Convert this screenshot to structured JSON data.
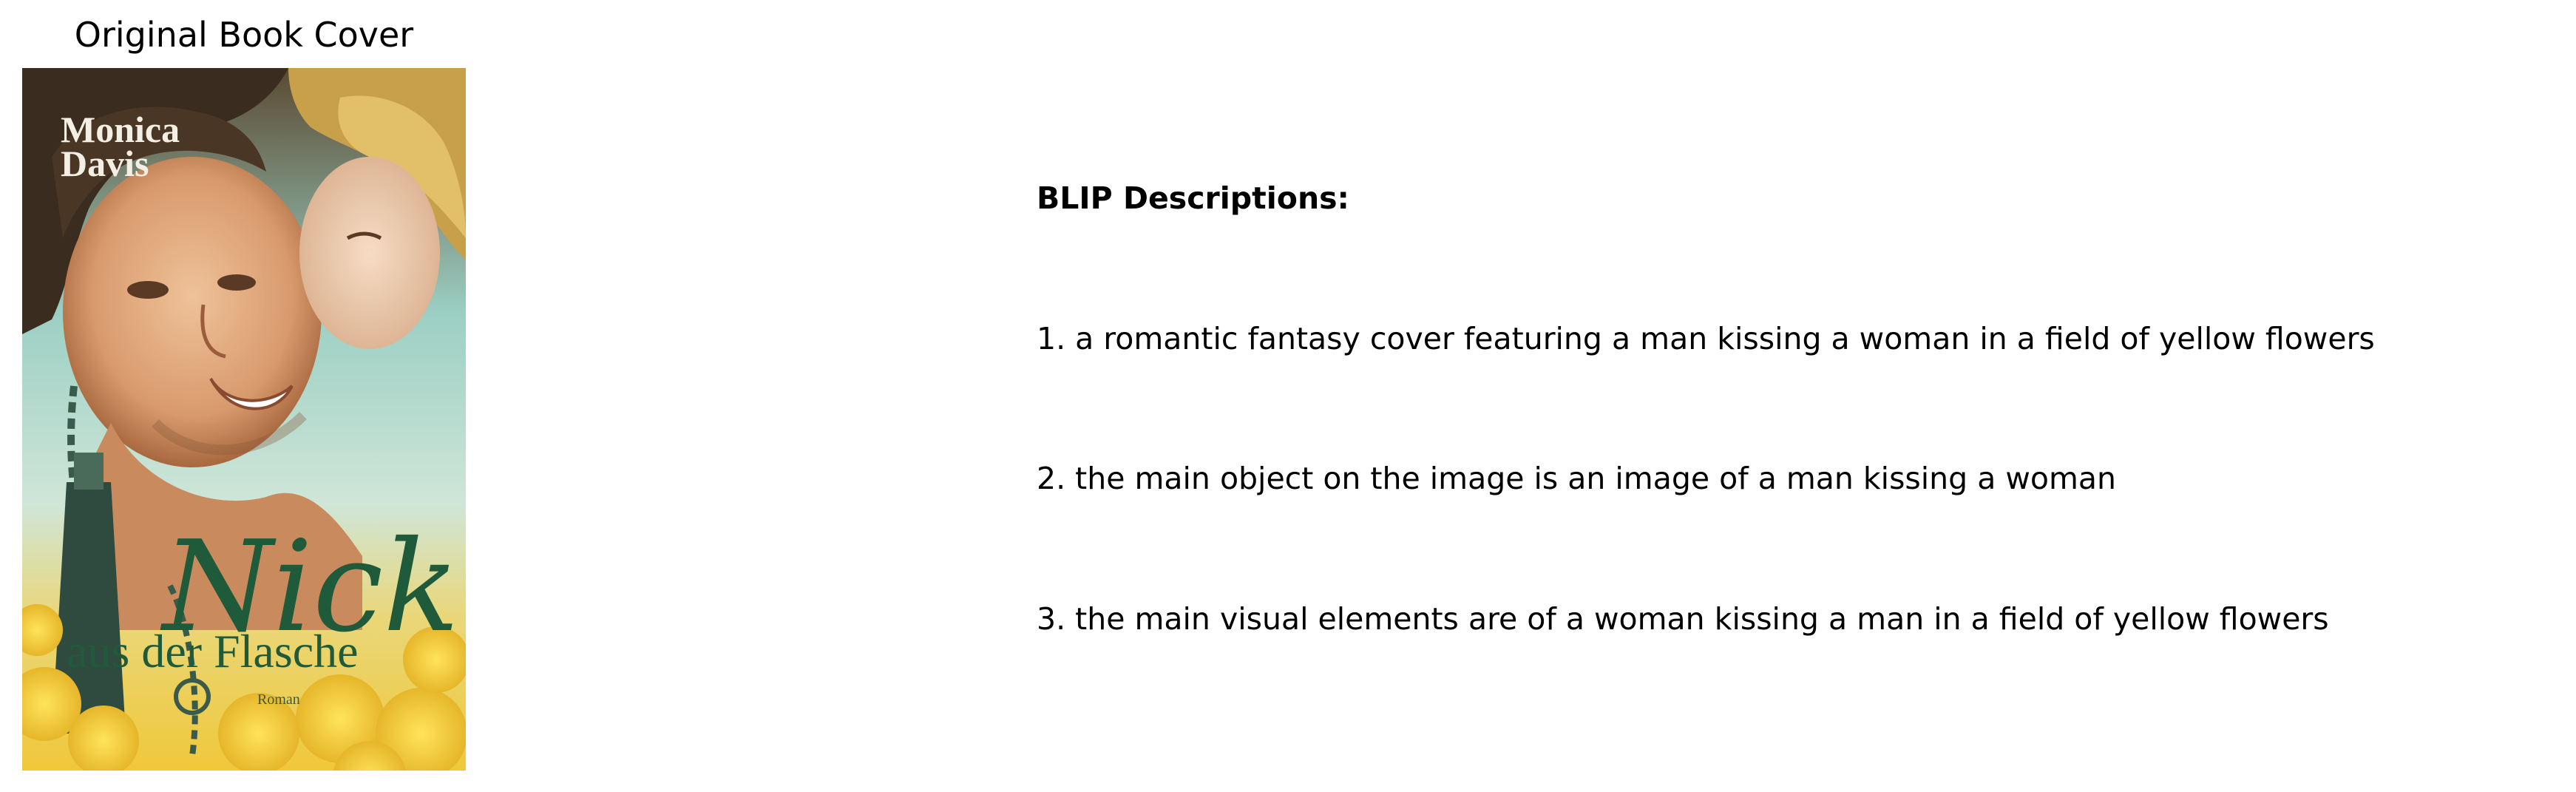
{
  "left_panel": {
    "title": "Original Book Cover",
    "cover": {
      "author": "Monica Davis",
      "title_script": "Nick",
      "title_rest": "aus der Flasche",
      "genre": "Roman"
    }
  },
  "right_panel": {
    "heading": "BLIP Descriptions:",
    "descriptions": [
      "1. a romantic fantasy cover featuring a man kissing a woman in a field of yellow flowers",
      "2. the main object on the image is an image of a man kissing a woman",
      "3. the main visual elements are of a woman kissing a man in a field of yellow flowers"
    ]
  },
  "colors": {
    "title_green": "#1f5b3a",
    "flowers_yellow": "#f2d23c",
    "sky_teal": "#8fd3d6",
    "skin": "#e0a77c"
  }
}
